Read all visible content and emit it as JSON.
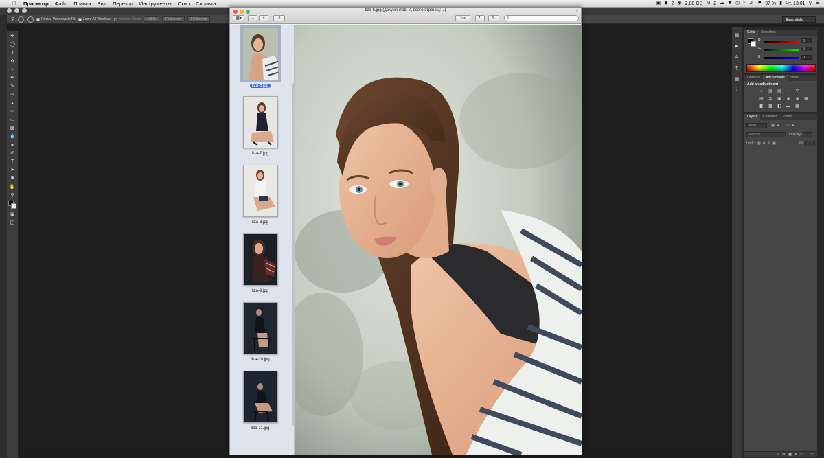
{
  "menubar": {
    "app": "Просмотр",
    "items": [
      "Файл",
      "Правка",
      "Вид",
      "Переход",
      "Инструменты",
      "Окно",
      "Справка"
    ],
    "status": {
      "disk": "2.88 GB",
      "battery": "97 %",
      "clock": "Чт, 13:01",
      "badge1": "2",
      "badge2": "2"
    }
  },
  "ps_options": {
    "resize": "Resize Windows to Fit",
    "zoom_all": "Zoom All Windows",
    "scrubby": "Scrubby Zoom",
    "zoom_pct": "100%",
    "fit": "Fit Screen",
    "fill": "Fill Screen",
    "workspace": "Essentials"
  },
  "viewer": {
    "title": "liza-6.jpg (документов: 7, всего страниц: 7)",
    "thumbnails": [
      "liza-6.jpg",
      "liza-7.jpg",
      "liza-8.jpg",
      "liza-9.jpg",
      "liza-10.jpg",
      "liza-11.jpg"
    ],
    "selected": "liza-6.jpg"
  },
  "panels": {
    "color_tabs": [
      "Color",
      "Swatches"
    ],
    "channels": [
      {
        "label": "R",
        "value": "0"
      },
      {
        "label": "G",
        "value": "0"
      },
      {
        "label": "B",
        "value": "0"
      }
    ],
    "adj_tabs": [
      "Libraries",
      "Adjustments",
      "Styles"
    ],
    "adj_title": "Add an adjustment",
    "layers_tabs": [
      "Layers",
      "Channels",
      "Paths"
    ],
    "kind": "Kind",
    "blend": "Normal",
    "opacity": "Opacity:",
    "lock": "Lock:",
    "fill": "Fill:"
  },
  "colors": {
    "selection": "#3d6fd6",
    "ps_bg": "#1e1e1e",
    "panel": "#454545"
  }
}
